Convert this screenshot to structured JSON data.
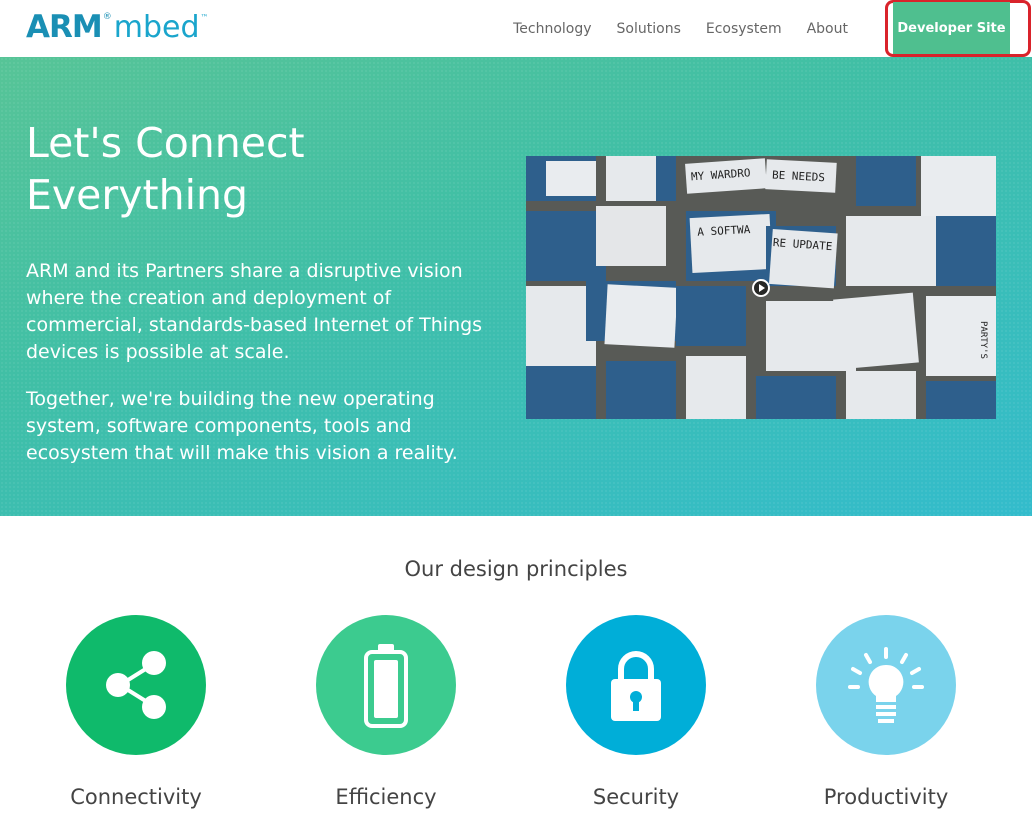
{
  "header": {
    "logo_arm": "ARM",
    "logo_registered": "®",
    "logo_mbed": "mbed",
    "logo_trademark": "™",
    "nav": [
      "Technology",
      "Solutions",
      "Ecosystem",
      "About"
    ],
    "developer_site": "Developer Site"
  },
  "hero": {
    "title": "Let's Connect Everything",
    "paragraph_1": "ARM and its Partners share a disruptive vision where the creation and deployment of commercial, standards-based Internet of Things devices is possible at scale.",
    "paragraph_2": "Together, we're building the new operating system, software components, tools and ecosystem that will make this vision a reality.",
    "video": {
      "sign_texts": [
        "MY WARDRO",
        "BE NEEDS",
        "A SOFTWA",
        "RE UPDATE",
        "PARTY'S"
      ]
    }
  },
  "principles": {
    "title": "Our design principles",
    "items": [
      {
        "label": "Connectivity",
        "icon": "share-icon",
        "color": "#0fba6b"
      },
      {
        "label": "Efficiency",
        "icon": "battery-icon",
        "color": "#3ccb8f"
      },
      {
        "label": "Security",
        "icon": "lock-icon",
        "color": "#00aed8"
      },
      {
        "label": "Productivity",
        "icon": "lightbulb-icon",
        "color": "#7ad3ec"
      }
    ]
  },
  "colors": {
    "brand_blue": "#1a8fb4",
    "developer_button": "#4fbf8f",
    "highlight_border": "#d9232b"
  }
}
